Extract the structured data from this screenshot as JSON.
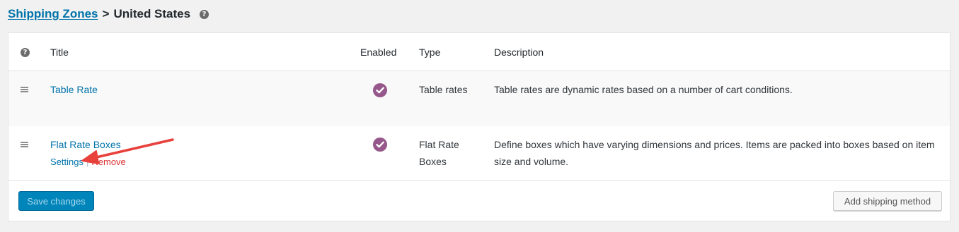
{
  "breadcrumb": {
    "parent": "Shipping Zones",
    "separator": ">",
    "current": "United States",
    "help": "?"
  },
  "table": {
    "header_help": "?",
    "columns": {
      "title": "Title",
      "enabled": "Enabled",
      "type": "Type",
      "description": "Description"
    },
    "rows": [
      {
        "title": "Table Rate",
        "enabled": true,
        "type": "Table rates",
        "description": "Table rates are dynamic rates based on a number of cart conditions."
      },
      {
        "title": "Flat Rate Boxes",
        "enabled": true,
        "type": "Flat Rate Boxes",
        "description": "Define boxes which have varying dimensions and prices. Items are packed into boxes based on item size and volume.",
        "actions": {
          "settings": "Settings",
          "separator": "|",
          "remove": "Remove"
        }
      }
    ]
  },
  "footer": {
    "save_label": "Save changes",
    "add_label": "Add shipping method"
  },
  "colors": {
    "link": "#0073aa",
    "enabled_badge": "#96588a",
    "remove": "#dc3232",
    "primary_button": "#0085ba",
    "annotation_arrow": "#e8413c"
  },
  "icons": {
    "help": "question-circle-icon",
    "drag": "drag-handle-icon",
    "enabled": "checkmark-circle-icon",
    "annotation": "red-arrow-icon"
  }
}
